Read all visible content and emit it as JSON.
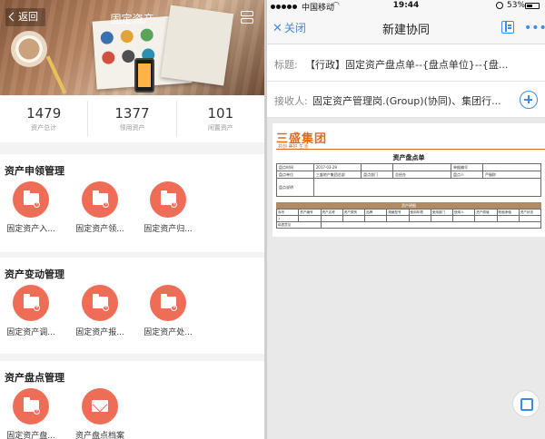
{
  "left": {
    "nav": {
      "back_label": "返回",
      "title": "固定资产"
    },
    "stats": [
      {
        "value": "1479",
        "label": "资产总计"
      },
      {
        "value": "1377",
        "label": "领用资产"
      },
      {
        "value": "101",
        "label": "闲置资产"
      }
    ],
    "sections": [
      {
        "title": "资产申领管理",
        "items": [
          "固定资产入...",
          "固定资产领...",
          "固定资产归..."
        ]
      },
      {
        "title": "资产变动管理",
        "items": [
          "固定资产调...",
          "固定资产报...",
          "固定资产处..."
        ]
      },
      {
        "title": "资产盘点管理",
        "items": [
          "固定资产盘...",
          "资产盘点档案"
        ]
      }
    ],
    "accent_color": "#ee6d57"
  },
  "right": {
    "statusbar": {
      "carrier": "中国移动",
      "time": "19:44",
      "battery": "53%",
      "battery_level": 0.53
    },
    "header": {
      "close_label": "关闭",
      "title": "新建协同"
    },
    "subject": {
      "label": "标题:",
      "value": "【行政】固定资产盘点单--{盘点单位}--{盘..."
    },
    "recipient": {
      "label": "接收人:",
      "value": "固定资产管理岗.(Group)(协同)、集团行..."
    },
    "document": {
      "brand": "三盛集团",
      "brand_sub": "共创 美好 生活",
      "title": "资产盘点单",
      "form_rows": [
        [
          "盘点时间",
          "2017-03-29",
          "",
          "",
          "单据编号",
          ""
        ],
        [
          "盘点单位",
          "三盛地产集团总部",
          "盘点部门",
          "总经办",
          "盘点人",
          "严福财"
        ]
      ],
      "remark_label": "盘点说明",
      "grid_title": "资产明细",
      "columns": [
        "序号",
        "资产编号",
        "资产名称",
        "资产类别",
        "品牌",
        "规格型号",
        "使用年限",
        "使用部门",
        "使用人",
        "资产原值",
        "账面净值",
        "资产状态"
      ],
      "row_index": "1",
      "summary_label": "填表意见"
    },
    "accent_color": "#3b8be9"
  }
}
